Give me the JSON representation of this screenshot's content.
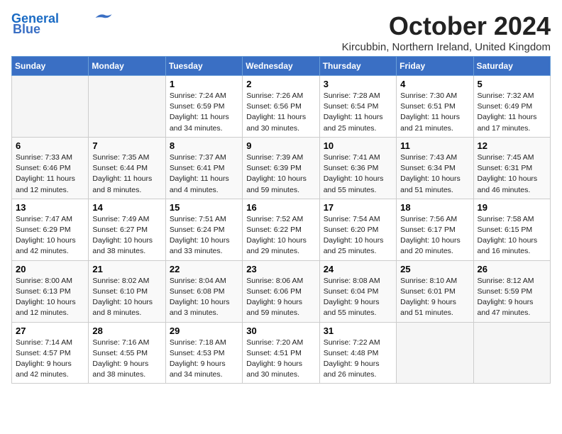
{
  "header": {
    "logo_line1": "General",
    "logo_line2": "Blue",
    "month_title": "October 2024",
    "location": "Kircubbin, Northern Ireland, United Kingdom"
  },
  "days_of_week": [
    "Sunday",
    "Monday",
    "Tuesday",
    "Wednesday",
    "Thursday",
    "Friday",
    "Saturday"
  ],
  "weeks": [
    [
      {
        "day": "",
        "info": ""
      },
      {
        "day": "",
        "info": ""
      },
      {
        "day": "1",
        "sunrise": "7:24 AM",
        "sunset": "6:59 PM",
        "daylight": "11 hours and 34 minutes."
      },
      {
        "day": "2",
        "sunrise": "7:26 AM",
        "sunset": "6:56 PM",
        "daylight": "11 hours and 30 minutes."
      },
      {
        "day": "3",
        "sunrise": "7:28 AM",
        "sunset": "6:54 PM",
        "daylight": "11 hours and 25 minutes."
      },
      {
        "day": "4",
        "sunrise": "7:30 AM",
        "sunset": "6:51 PM",
        "daylight": "11 hours and 21 minutes."
      },
      {
        "day": "5",
        "sunrise": "7:32 AM",
        "sunset": "6:49 PM",
        "daylight": "11 hours and 17 minutes."
      }
    ],
    [
      {
        "day": "6",
        "sunrise": "7:33 AM",
        "sunset": "6:46 PM",
        "daylight": "11 hours and 12 minutes."
      },
      {
        "day": "7",
        "sunrise": "7:35 AM",
        "sunset": "6:44 PM",
        "daylight": "11 hours and 8 minutes."
      },
      {
        "day": "8",
        "sunrise": "7:37 AM",
        "sunset": "6:41 PM",
        "daylight": "11 hours and 4 minutes."
      },
      {
        "day": "9",
        "sunrise": "7:39 AM",
        "sunset": "6:39 PM",
        "daylight": "10 hours and 59 minutes."
      },
      {
        "day": "10",
        "sunrise": "7:41 AM",
        "sunset": "6:36 PM",
        "daylight": "10 hours and 55 minutes."
      },
      {
        "day": "11",
        "sunrise": "7:43 AM",
        "sunset": "6:34 PM",
        "daylight": "10 hours and 51 minutes."
      },
      {
        "day": "12",
        "sunrise": "7:45 AM",
        "sunset": "6:31 PM",
        "daylight": "10 hours and 46 minutes."
      }
    ],
    [
      {
        "day": "13",
        "sunrise": "7:47 AM",
        "sunset": "6:29 PM",
        "daylight": "10 hours and 42 minutes."
      },
      {
        "day": "14",
        "sunrise": "7:49 AM",
        "sunset": "6:27 PM",
        "daylight": "10 hours and 38 minutes."
      },
      {
        "day": "15",
        "sunrise": "7:51 AM",
        "sunset": "6:24 PM",
        "daylight": "10 hours and 33 minutes."
      },
      {
        "day": "16",
        "sunrise": "7:52 AM",
        "sunset": "6:22 PM",
        "daylight": "10 hours and 29 minutes."
      },
      {
        "day": "17",
        "sunrise": "7:54 AM",
        "sunset": "6:20 PM",
        "daylight": "10 hours and 25 minutes."
      },
      {
        "day": "18",
        "sunrise": "7:56 AM",
        "sunset": "6:17 PM",
        "daylight": "10 hours and 20 minutes."
      },
      {
        "day": "19",
        "sunrise": "7:58 AM",
        "sunset": "6:15 PM",
        "daylight": "10 hours and 16 minutes."
      }
    ],
    [
      {
        "day": "20",
        "sunrise": "8:00 AM",
        "sunset": "6:13 PM",
        "daylight": "10 hours and 12 minutes."
      },
      {
        "day": "21",
        "sunrise": "8:02 AM",
        "sunset": "6:10 PM",
        "daylight": "10 hours and 8 minutes."
      },
      {
        "day": "22",
        "sunrise": "8:04 AM",
        "sunset": "6:08 PM",
        "daylight": "10 hours and 3 minutes."
      },
      {
        "day": "23",
        "sunrise": "8:06 AM",
        "sunset": "6:06 PM",
        "daylight": "9 hours and 59 minutes."
      },
      {
        "day": "24",
        "sunrise": "8:08 AM",
        "sunset": "6:04 PM",
        "daylight": "9 hours and 55 minutes."
      },
      {
        "day": "25",
        "sunrise": "8:10 AM",
        "sunset": "6:01 PM",
        "daylight": "9 hours and 51 minutes."
      },
      {
        "day": "26",
        "sunrise": "8:12 AM",
        "sunset": "5:59 PM",
        "daylight": "9 hours and 47 minutes."
      }
    ],
    [
      {
        "day": "27",
        "sunrise": "7:14 AM",
        "sunset": "4:57 PM",
        "daylight": "9 hours and 42 minutes."
      },
      {
        "day": "28",
        "sunrise": "7:16 AM",
        "sunset": "4:55 PM",
        "daylight": "9 hours and 38 minutes."
      },
      {
        "day": "29",
        "sunrise": "7:18 AM",
        "sunset": "4:53 PM",
        "daylight": "9 hours and 34 minutes."
      },
      {
        "day": "30",
        "sunrise": "7:20 AM",
        "sunset": "4:51 PM",
        "daylight": "9 hours and 30 minutes."
      },
      {
        "day": "31",
        "sunrise": "7:22 AM",
        "sunset": "4:48 PM",
        "daylight": "9 hours and 26 minutes."
      },
      {
        "day": "",
        "info": ""
      },
      {
        "day": "",
        "info": ""
      }
    ]
  ]
}
